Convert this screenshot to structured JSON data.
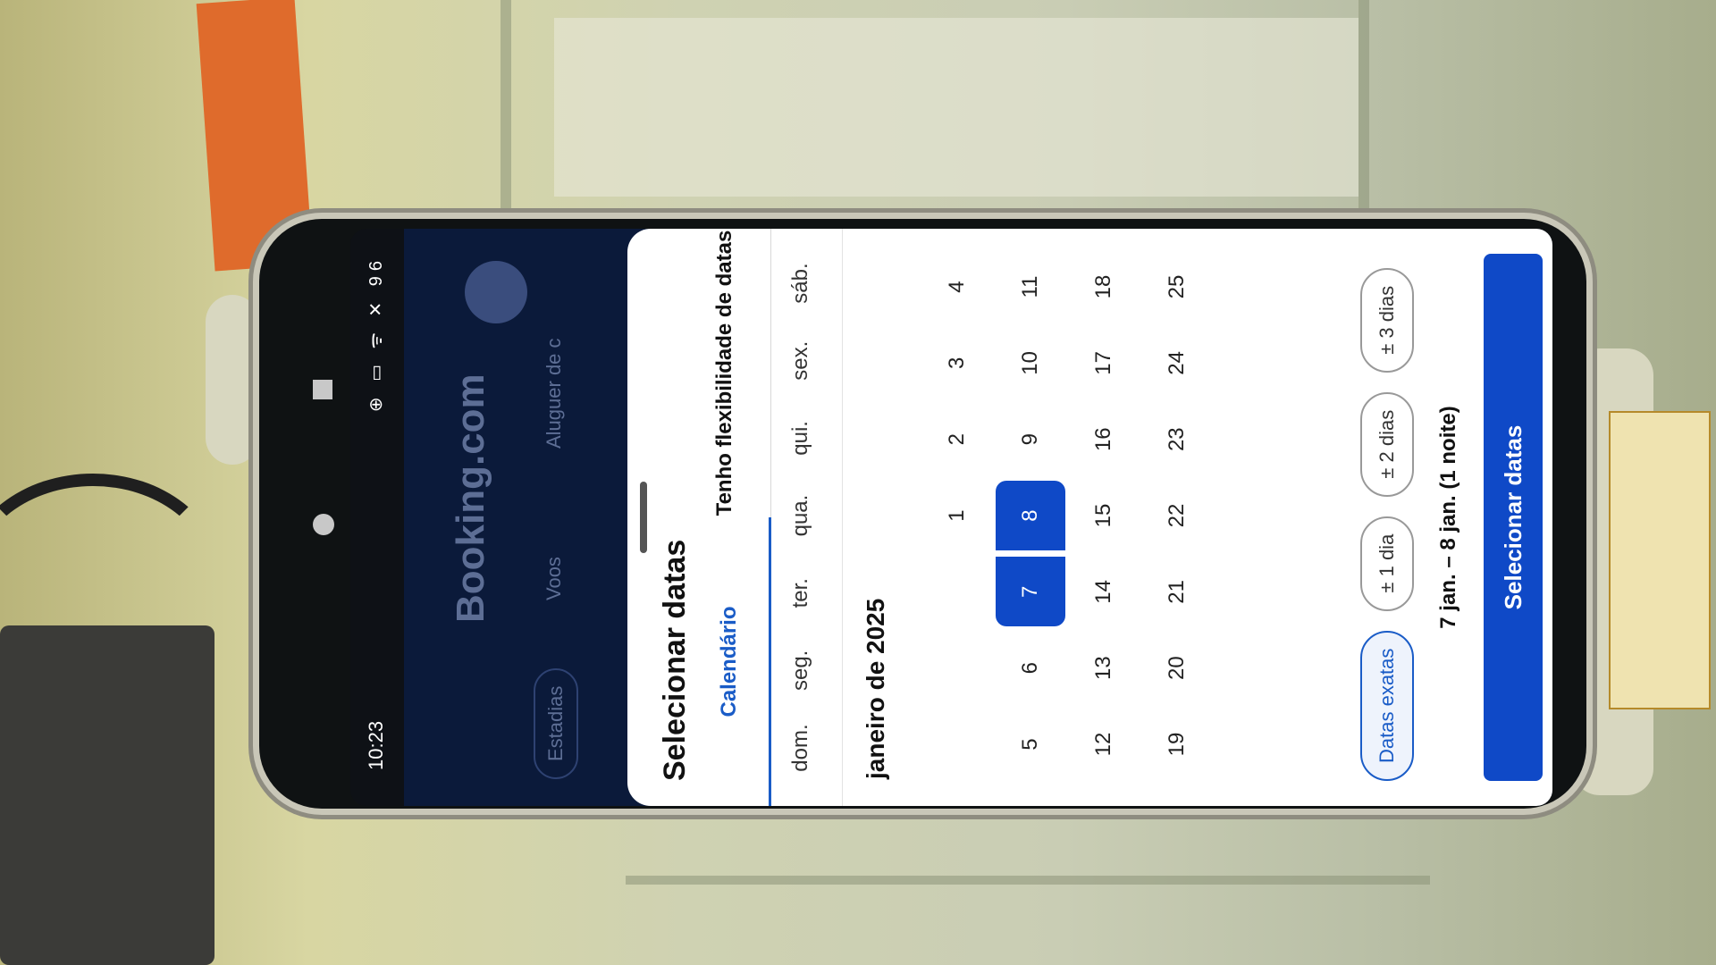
{
  "status_bar": {
    "time": "10:23",
    "icons": "⊕ ▭   ᯤ ✕ 96"
  },
  "background_app": {
    "brand": "Booking.com",
    "tabs": [
      {
        "label": "Estadias"
      },
      {
        "label": "Voos"
      },
      {
        "label": "Aluguer de c"
      }
    ]
  },
  "sheet": {
    "title": "Selecionar datas",
    "tabs": [
      {
        "label": "Calendário"
      },
      {
        "label": "Tenho flexibilidade de datas"
      }
    ],
    "weekdays": [
      "dom.",
      "seg.",
      "ter.",
      "qua.",
      "qui.",
      "sex.",
      "sáb."
    ],
    "month": "janeiro de 2025",
    "weeks": [
      [
        "",
        "",
        "",
        "1",
        "2",
        "3",
        "4"
      ],
      [
        "5",
        "6",
        "7",
        "8",
        "9",
        "10",
        "11"
      ],
      [
        "12",
        "13",
        "14",
        "15",
        "16",
        "17",
        "18"
      ],
      [
        "19",
        "20",
        "21",
        "22",
        "23",
        "24",
        "25"
      ]
    ],
    "flex_options": [
      "Datas exatas",
      "± 1 dia",
      "± 2 dias",
      "± 3 dias"
    ],
    "summary": "7 jan. – 8 jan. (1 noite)",
    "cta": "Selecionar datas"
  },
  "colors": {
    "accent": "#0f49c7",
    "brand_bg": "#0b1a3a"
  }
}
